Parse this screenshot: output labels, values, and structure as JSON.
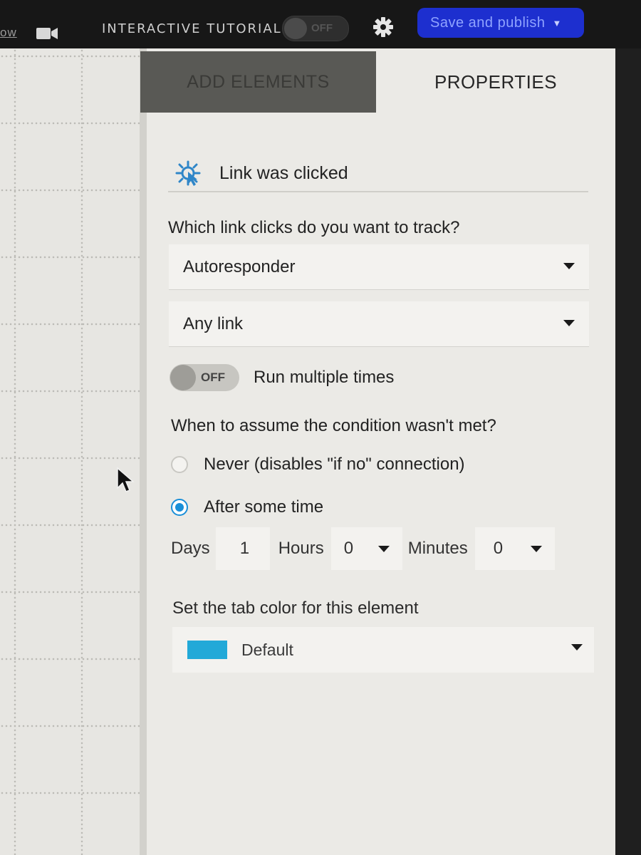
{
  "topbar": {
    "left_link": "ow",
    "video_icon": "video-camera-icon",
    "tutorial_label": "INTERACTIVE TUTORIAL",
    "tutorial_toggle": "OFF",
    "settings_icon": "gear-icon",
    "publish_label": "Save and publish"
  },
  "tabs": {
    "add_elements": "ADD ELEMENTS",
    "properties": "PROPERTIES"
  },
  "element": {
    "icon": "click-burst-icon",
    "title": "Link was clicked"
  },
  "form": {
    "question": "Which link clicks do you want to track?",
    "message_select": "Autoresponder",
    "link_select": "Any link",
    "run_toggle_state": "OFF",
    "run_label": "Run multiple times",
    "condition_label": "When to assume the condition wasn't met?",
    "radio_never": "Never (disables \"if no\" connection)",
    "radio_after": "After some time",
    "radio_selected": "After some time",
    "days_label": "Days",
    "days_value": "1",
    "hours_label": "Hours",
    "hours_value": "0",
    "minutes_label": "Minutes",
    "minutes_value": "0",
    "color_label": "Set the tab color for this element",
    "color_value": "Default",
    "color_swatch": "#22a9d8"
  },
  "colors": {
    "publish_button": "#1d2fcf",
    "radio_accent": "#1a8fd8"
  }
}
